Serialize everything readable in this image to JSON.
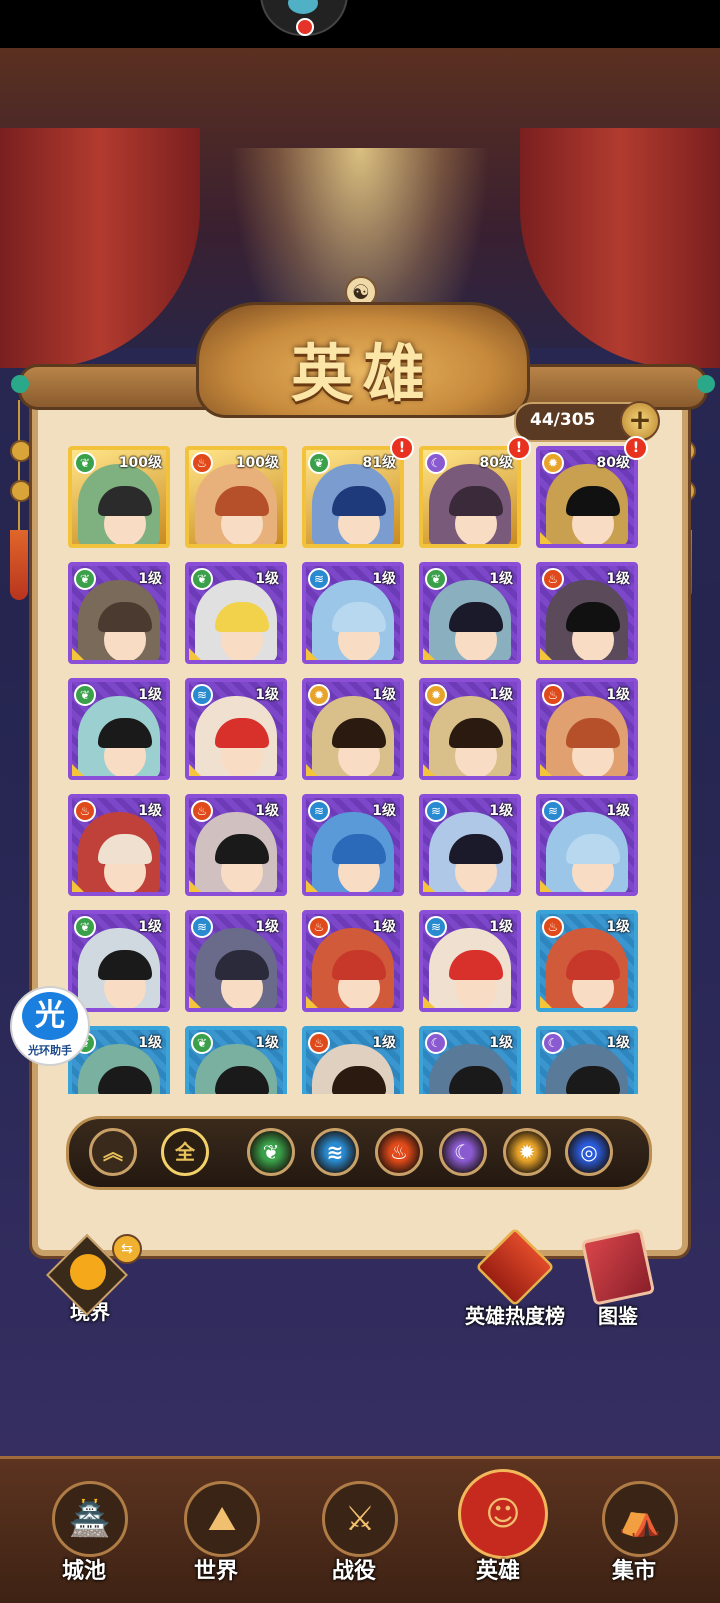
{
  "title": "英雄",
  "hero_count": "44/305",
  "add_icon": "plus-icon",
  "heroes": [
    {
      "level": "100级",
      "element": "leaf",
      "frame": "gold",
      "alert": false,
      "hair": "#2b2b2b",
      "bg": "#7fb07f"
    },
    {
      "level": "100级",
      "element": "fire",
      "frame": "gold",
      "alert": false,
      "hair": "#b6502a",
      "bg": "#e8b07a"
    },
    {
      "level": "81级",
      "element": "leaf",
      "frame": "gold",
      "alert": true,
      "hair": "#1f3a7a",
      "bg": "#7a9ccf"
    },
    {
      "level": "80级",
      "element": "moon",
      "frame": "gold",
      "alert": true,
      "hair": "#3a2a3a",
      "bg": "#7a5a7a"
    },
    {
      "level": "80级",
      "element": "sun",
      "frame": "purple",
      "alert": true,
      "hair": "#111111",
      "bg": "#c9a050"
    },
    {
      "level": "1级",
      "element": "leaf",
      "frame": "purple",
      "alert": false,
      "hair": "#4a3a30",
      "bg": "#7a6a5a"
    },
    {
      "level": "1级",
      "element": "leaf",
      "frame": "purple",
      "alert": false,
      "hair": "#f2d24a",
      "bg": "#e0e0e0"
    },
    {
      "level": "1级",
      "element": "water",
      "frame": "purple",
      "alert": false,
      "hair": "#b8d8f0",
      "bg": "#9cc6e8"
    },
    {
      "level": "1级",
      "element": "leaf",
      "frame": "purple",
      "alert": false,
      "hair": "#1a1a2a",
      "bg": "#8ab0c0"
    },
    {
      "level": "1级",
      "element": "fire",
      "frame": "purple",
      "alert": false,
      "hair": "#111111",
      "bg": "#5a4a5a"
    },
    {
      "level": "1级",
      "element": "leaf",
      "frame": "purple",
      "alert": false,
      "hair": "#1a1a1a",
      "bg": "#9ccfcf"
    },
    {
      "level": "1级",
      "element": "water",
      "frame": "purple",
      "alert": false,
      "hair": "#d8302a",
      "bg": "#f0e0d0"
    },
    {
      "level": "1级",
      "element": "sun",
      "frame": "purple",
      "alert": false,
      "hair": "#2a1a10",
      "bg": "#d9c08a"
    },
    {
      "level": "1级",
      "element": "sun",
      "frame": "purple",
      "alert": false,
      "hair": "#2a1a10",
      "bg": "#d9c08a"
    },
    {
      "level": "1级",
      "element": "fire",
      "frame": "purple",
      "alert": false,
      "hair": "#b6502a",
      "bg": "#e0a070"
    },
    {
      "level": "1级",
      "element": "fire",
      "frame": "purple",
      "alert": false,
      "hair": "#f0e0d0",
      "bg": "#c0403a"
    },
    {
      "level": "1级",
      "element": "fire",
      "frame": "purple",
      "alert": false,
      "hair": "#1a1a1a",
      "bg": "#d0c0c0"
    },
    {
      "level": "1级",
      "element": "water",
      "frame": "purple",
      "alert": false,
      "hair": "#2a6ab8",
      "bg": "#5a9ad8"
    },
    {
      "level": "1级",
      "element": "water",
      "frame": "purple",
      "alert": false,
      "hair": "#1a1a2a",
      "bg": "#b0c8e8"
    },
    {
      "level": "1级",
      "element": "water",
      "frame": "purple",
      "alert": false,
      "hair": "#b8d8f0",
      "bg": "#9cc6e8"
    },
    {
      "level": "1级",
      "element": "leaf",
      "frame": "purple",
      "alert": false,
      "hair": "#1a1a1a",
      "bg": "#d0d8e0"
    },
    {
      "level": "1级",
      "element": "water",
      "frame": "purple",
      "alert": false,
      "hair": "#2a2a3a",
      "bg": "#6a6a8a"
    },
    {
      "level": "1级",
      "element": "fire",
      "frame": "purple",
      "alert": false,
      "hair": "#c8382a",
      "bg": "#d05a3a"
    },
    {
      "level": "1级",
      "element": "water",
      "frame": "purple",
      "alert": false,
      "hair": "#d8302a",
      "bg": "#f0e0d0"
    },
    {
      "level": "1级",
      "element": "fire",
      "frame": "blue",
      "alert": false,
      "hair": "#c8382a",
      "bg": "#d05a3a"
    },
    {
      "level": "1级",
      "element": "leaf",
      "frame": "blue",
      "alert": false,
      "hair": "#1a1a1a",
      "bg": "#7ab0a0"
    },
    {
      "level": "1级",
      "element": "leaf",
      "frame": "blue",
      "alert": false,
      "hair": "#1a1a1a",
      "bg": "#7ab0a0"
    },
    {
      "level": "1级",
      "element": "fire",
      "frame": "blue",
      "alert": false,
      "hair": "#2a1a10",
      "bg": "#e0d0c0"
    },
    {
      "level": "1级",
      "element": "moon",
      "frame": "blue",
      "alert": false,
      "hair": "#1a1a1a",
      "bg": "#5a7a9a"
    },
    {
      "level": "1级",
      "element": "moon",
      "frame": "blue",
      "alert": false,
      "hair": "#1a1a1a",
      "bg": "#5a7a9a"
    }
  ],
  "filters": [
    {
      "name": "collapse",
      "label": "",
      "icon": "double-chevron-up-icon",
      "color": "#e8c25a"
    },
    {
      "name": "all",
      "label": "全",
      "icon": "all-icon",
      "color": "#e8c25a"
    },
    {
      "name": "leaf",
      "label": "",
      "icon": "leaf-icon",
      "color": "#3aa04a"
    },
    {
      "name": "water",
      "label": "",
      "icon": "water-icon",
      "color": "#2a8ad0"
    },
    {
      "name": "fire",
      "label": "",
      "icon": "fire-icon",
      "color": "#e04a1a"
    },
    {
      "name": "moon",
      "label": "",
      "icon": "moon-icon",
      "color": "#8a5ad0"
    },
    {
      "name": "sun",
      "label": "",
      "icon": "sun-icon",
      "color": "#e8a42a"
    },
    {
      "name": "vortex",
      "label": "",
      "icon": "vortex-icon",
      "color": "#2a5ad8"
    }
  ],
  "side": {
    "realm": "境界",
    "ranking": "英雄热度榜",
    "codex": "图鉴"
  },
  "helper": {
    "glyph": "光",
    "label": "光环助手"
  },
  "nav": [
    {
      "label": "城池",
      "icon": "castle-icon",
      "active": false
    },
    {
      "label": "世界",
      "icon": "mountain-icon",
      "active": false
    },
    {
      "label": "战役",
      "icon": "crossed-swords-icon",
      "active": false
    },
    {
      "label": "英雄",
      "icon": "hero-icon",
      "active": true
    },
    {
      "label": "集市",
      "icon": "market-icon",
      "active": false
    }
  ],
  "element_colors": {
    "leaf": "#3aa04a",
    "fire": "#e04a1a",
    "water": "#2a8ad0",
    "moon": "#8a5ad0",
    "sun": "#e8a42a"
  }
}
